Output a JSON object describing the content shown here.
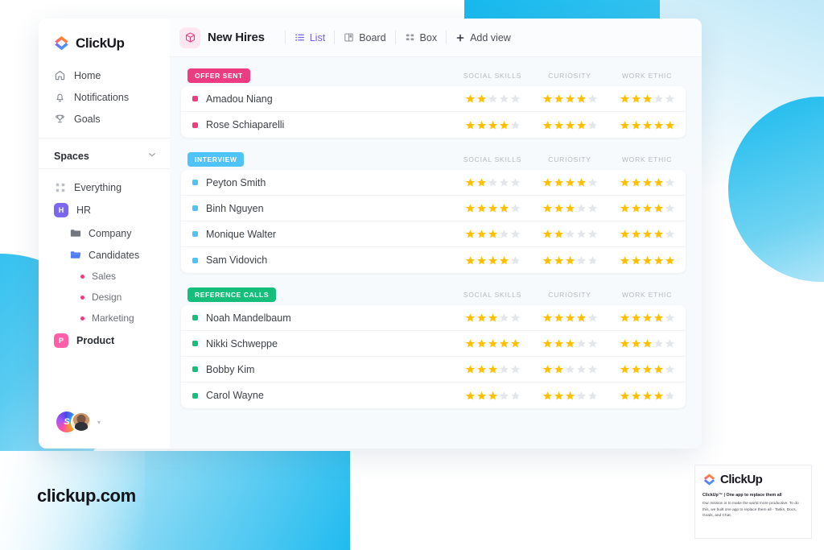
{
  "brand": {
    "name": "ClickUp",
    "logo_icon": "clickup-logo-icon"
  },
  "sidebar": {
    "nav": [
      {
        "label": "Home",
        "icon": "home-icon"
      },
      {
        "label": "Notifications",
        "icon": "bell-icon"
      },
      {
        "label": "Goals",
        "icon": "trophy-icon"
      }
    ],
    "section_label": "Spaces",
    "section_chevron": "chevron-down-icon",
    "everything": {
      "label": "Everything",
      "icon": "grid-dots-icon"
    },
    "spaces": [
      {
        "label": "HR",
        "initial": "H",
        "color": "#7B68EE"
      },
      {
        "label": "Product",
        "initial": "P",
        "color": "#FF5FA8"
      }
    ],
    "folders": [
      {
        "label": "Company",
        "icon": "folder-closed-icon",
        "color": "#6b7280"
      },
      {
        "label": "Candidates",
        "icon": "folder-open-icon",
        "color": "#4f7df3"
      }
    ],
    "lists": [
      {
        "label": "Sales",
        "color": "#F6397F"
      },
      {
        "label": "Design",
        "color": "#F6397F"
      },
      {
        "label": "Marketing",
        "color": "#F6397F"
      }
    ],
    "footer": {
      "avatar_initial": "S",
      "avatar_name": "avatar-gradient",
      "photo_name": "avatar-photo",
      "caret": "▾"
    }
  },
  "toolbar": {
    "view_icon": "cube-icon",
    "title": "New Hires",
    "tabs": [
      {
        "label": "List",
        "icon": "list-icon",
        "active": true
      },
      {
        "label": "Board",
        "icon": "board-icon",
        "active": false
      },
      {
        "label": "Box",
        "icon": "box-grid-icon",
        "active": false
      }
    ],
    "add_view_label": "Add view",
    "add_view_icon": "plus-icon"
  },
  "columns": [
    "SOCIAL SKILLS",
    "CURIOSITY",
    "WORK ETHIC"
  ],
  "max_rating": 5,
  "colors": {
    "offer_sent": "#EC3D82",
    "interview": "#4EC3F7",
    "reference_calls": "#15BE7B",
    "star_filled": "#FFC107",
    "star_empty": "#E3E6EA",
    "accent_purple": "#7A5DF0"
  },
  "groups": [
    {
      "status": "OFFER SENT",
      "color": "#EC3D82",
      "rows": [
        {
          "name": "Amadou Niang",
          "social_skills": 2,
          "curiosity": 4,
          "work_ethic": 3
        },
        {
          "name": "Rose Schiaparelli",
          "social_skills": 4,
          "curiosity": 4,
          "work_ethic": 5
        }
      ]
    },
    {
      "status": "INTERVIEW",
      "color": "#4EC3F7",
      "rows": [
        {
          "name": "Peyton Smith",
          "social_skills": 2,
          "curiosity": 4,
          "work_ethic": 4
        },
        {
          "name": "Binh Nguyen",
          "social_skills": 4,
          "curiosity": 3,
          "work_ethic": 4
        },
        {
          "name": "Monique Walter",
          "social_skills": 3,
          "curiosity": 2,
          "work_ethic": 4
        },
        {
          "name": "Sam Vidovich",
          "social_skills": 4,
          "curiosity": 3,
          "work_ethic": 5
        }
      ]
    },
    {
      "status": "REFERENCE CALLS",
      "color": "#15BE7B",
      "rows": [
        {
          "name": "Noah Mandelbaum",
          "social_skills": 3,
          "curiosity": 4,
          "work_ethic": 4
        },
        {
          "name": "Nikki Schweppe",
          "social_skills": 5,
          "curiosity": 3,
          "work_ethic": 3
        },
        {
          "name": "Bobby Kim",
          "social_skills": 3,
          "curiosity": 2,
          "work_ethic": 4
        },
        {
          "name": "Carol Wayne",
          "social_skills": 3,
          "curiosity": 3,
          "work_ethic": 4
        }
      ]
    }
  ],
  "watermark": {
    "text": "clickup.com"
  },
  "promo": {
    "logo_text": "ClickUp",
    "headline": "ClickUp™ | One app to replace them all",
    "body": "Our mission is to make the world more productive. To do this, we built one app to replace them all - Tasks, Docs, Goals, and Chat."
  }
}
